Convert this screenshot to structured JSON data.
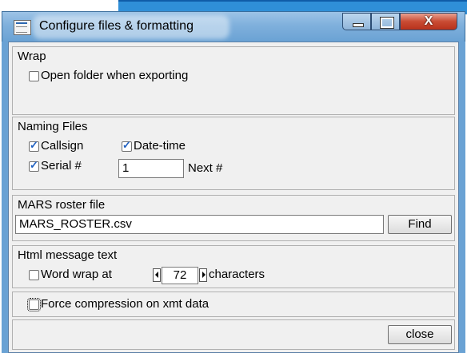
{
  "window": {
    "title": "Configure files & formatting",
    "close_glyph": "X"
  },
  "wrap": {
    "title": "Wrap",
    "open_folder_label": "Open folder when exporting",
    "open_folder_checked": false
  },
  "naming": {
    "title": "Naming Files",
    "callsign_label": "Callsign",
    "callsign_checked": true,
    "datetime_label": "Date-time",
    "datetime_checked": true,
    "serial_label": "Serial #",
    "serial_checked": true,
    "next_value": "1",
    "next_label": "Next #"
  },
  "roster": {
    "title": "MARS roster file",
    "file_value": "MARS_ROSTER.csv",
    "find_label": "Find"
  },
  "html": {
    "title": "Html message text",
    "word_wrap_label": "Word wrap at",
    "word_wrap_checked": false,
    "wrap_value": "72",
    "characters_label": "characters"
  },
  "compression": {
    "label": "Force compression on xmt data",
    "checked": false
  },
  "footer": {
    "close_label": "close"
  }
}
